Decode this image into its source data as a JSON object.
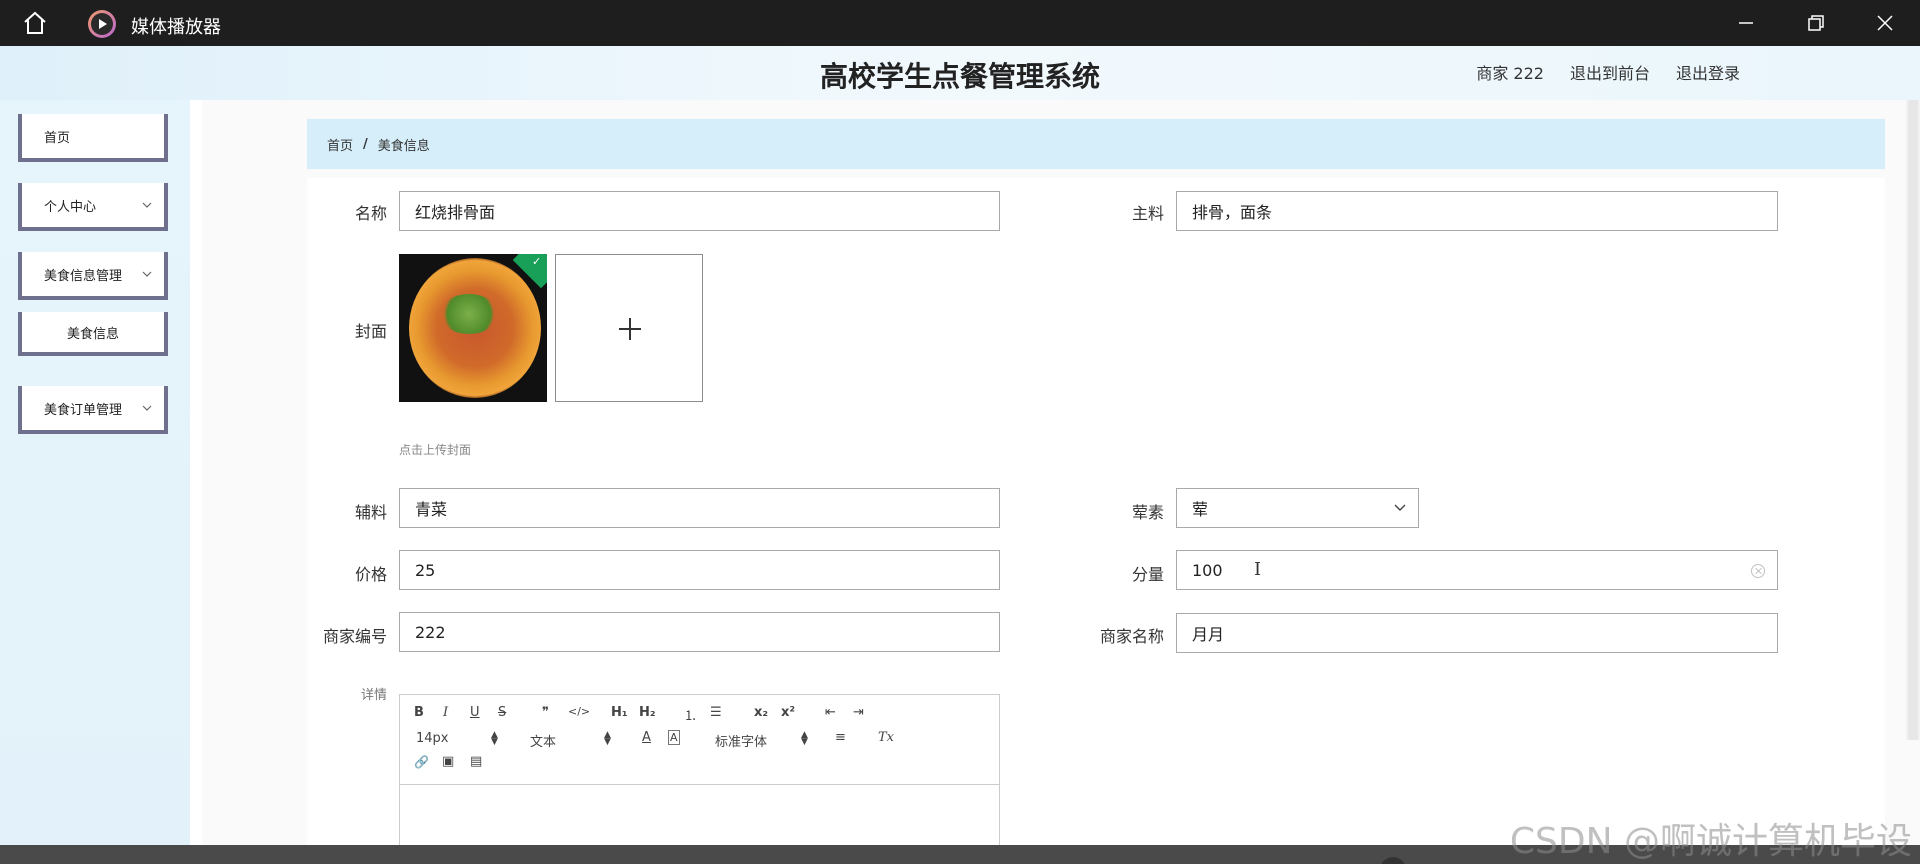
{
  "window": {
    "app_title": "媒体播放器",
    "home_icon": "home-icon",
    "app_icon": "play-icon",
    "controls": [
      "minimize-icon",
      "restore-icon",
      "close-icon"
    ]
  },
  "header": {
    "title": "高校学生点餐管理系统",
    "merchant": "商家 222",
    "to_front": "退出到前台",
    "logout": "退出登录"
  },
  "sidebar": {
    "items": [
      {
        "label": "首页"
      },
      {
        "label": "个人中心"
      },
      {
        "label": "美食信息管理"
      },
      {
        "label": "美食信息"
      },
      {
        "label": "美食订单管理"
      }
    ]
  },
  "breadcrumb": {
    "home": "首页",
    "separator": "/",
    "current": "美食信息"
  },
  "form": {
    "name_label": "名称",
    "name_value": "红烧排骨面",
    "main_label": "主料",
    "main_value": "排骨，面条",
    "cover_label": "封面",
    "upload_tip": "点击上传封面",
    "aux_label": "辅料",
    "aux_value": "青菜",
    "meat_label": "荤素",
    "meat_value": "荤",
    "price_label": "价格",
    "price_value": "25",
    "portion_label": "分量",
    "portion_value": "100",
    "merchant_no_label": "商家编号",
    "merchant_no_value": "222",
    "merchant_name_label": "商家名称",
    "merchant_name_value": "月月",
    "detail_label": "详情"
  },
  "editor": {
    "bold": "B",
    "italic": "I",
    "underline": "U",
    "strike": "S",
    "quote": "❞",
    "code": "</>",
    "h1": "H₁",
    "h2": "H₂",
    "ordered_list": "⒈",
    "bullet_list": "☰",
    "subscript": "x₂",
    "superscript": "x²",
    "outdent": "⇤",
    "indent": "⇥",
    "font_size": "14px",
    "text_type": "文本",
    "font_color": "A",
    "bg_color": "A",
    "font_family": "标准字体",
    "align": "≡",
    "clear_format": "Tx",
    "link": "🔗",
    "image": "▣",
    "video": "▤"
  },
  "watermark": "CSDN @啊诚计算机毕设",
  "colors": {
    "titlebar": "#1e1e1e",
    "breadcrumb_bg": "#d6eef9",
    "menu_border": "#6f6f8e",
    "upload_check": "#18a058"
  }
}
